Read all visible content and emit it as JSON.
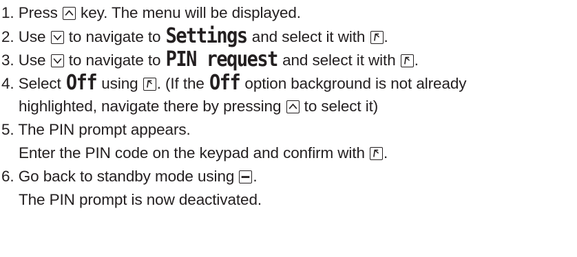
{
  "steps": [
    {
      "num": "1.",
      "t1": " Press ",
      "t2": " key. The menu will be displayed."
    },
    {
      "num": "2.",
      "t1": " Use ",
      "t2": " to navigate to ",
      "menu": "Settings",
      "t3": " and select it with ",
      "t4": "."
    },
    {
      "num": "3.",
      "t1": " Use ",
      "t2": " to navigate to ",
      "menu": "PIN request",
      "t3": " and select it with ",
      "t4": "."
    },
    {
      "num": "4.",
      "t1": " Select ",
      "menu": "Off",
      "t2": " using ",
      "t3": ". (If the ",
      "menu2": "Off",
      "t4": " option background is not already",
      "cont_t1": "highlighted, navigate there by pressing ",
      "cont_t2": " to select it)"
    },
    {
      "num": "5.",
      "t1": " The PIN prompt appears.",
      "cont_t1": "Enter the PIN code on the keypad and confirm with ",
      "cont_t2": "."
    },
    {
      "num": "6.",
      "t1": " Go back to standby mode using ",
      "t2": ".",
      "cont_t1": "The PIN prompt is now deactivated."
    }
  ],
  "icons": {
    "up": "up-arrow-key-icon",
    "down": "down-arrow-key-icon",
    "ok": "ok-select-key-icon",
    "back": "back-standby-key-icon"
  }
}
